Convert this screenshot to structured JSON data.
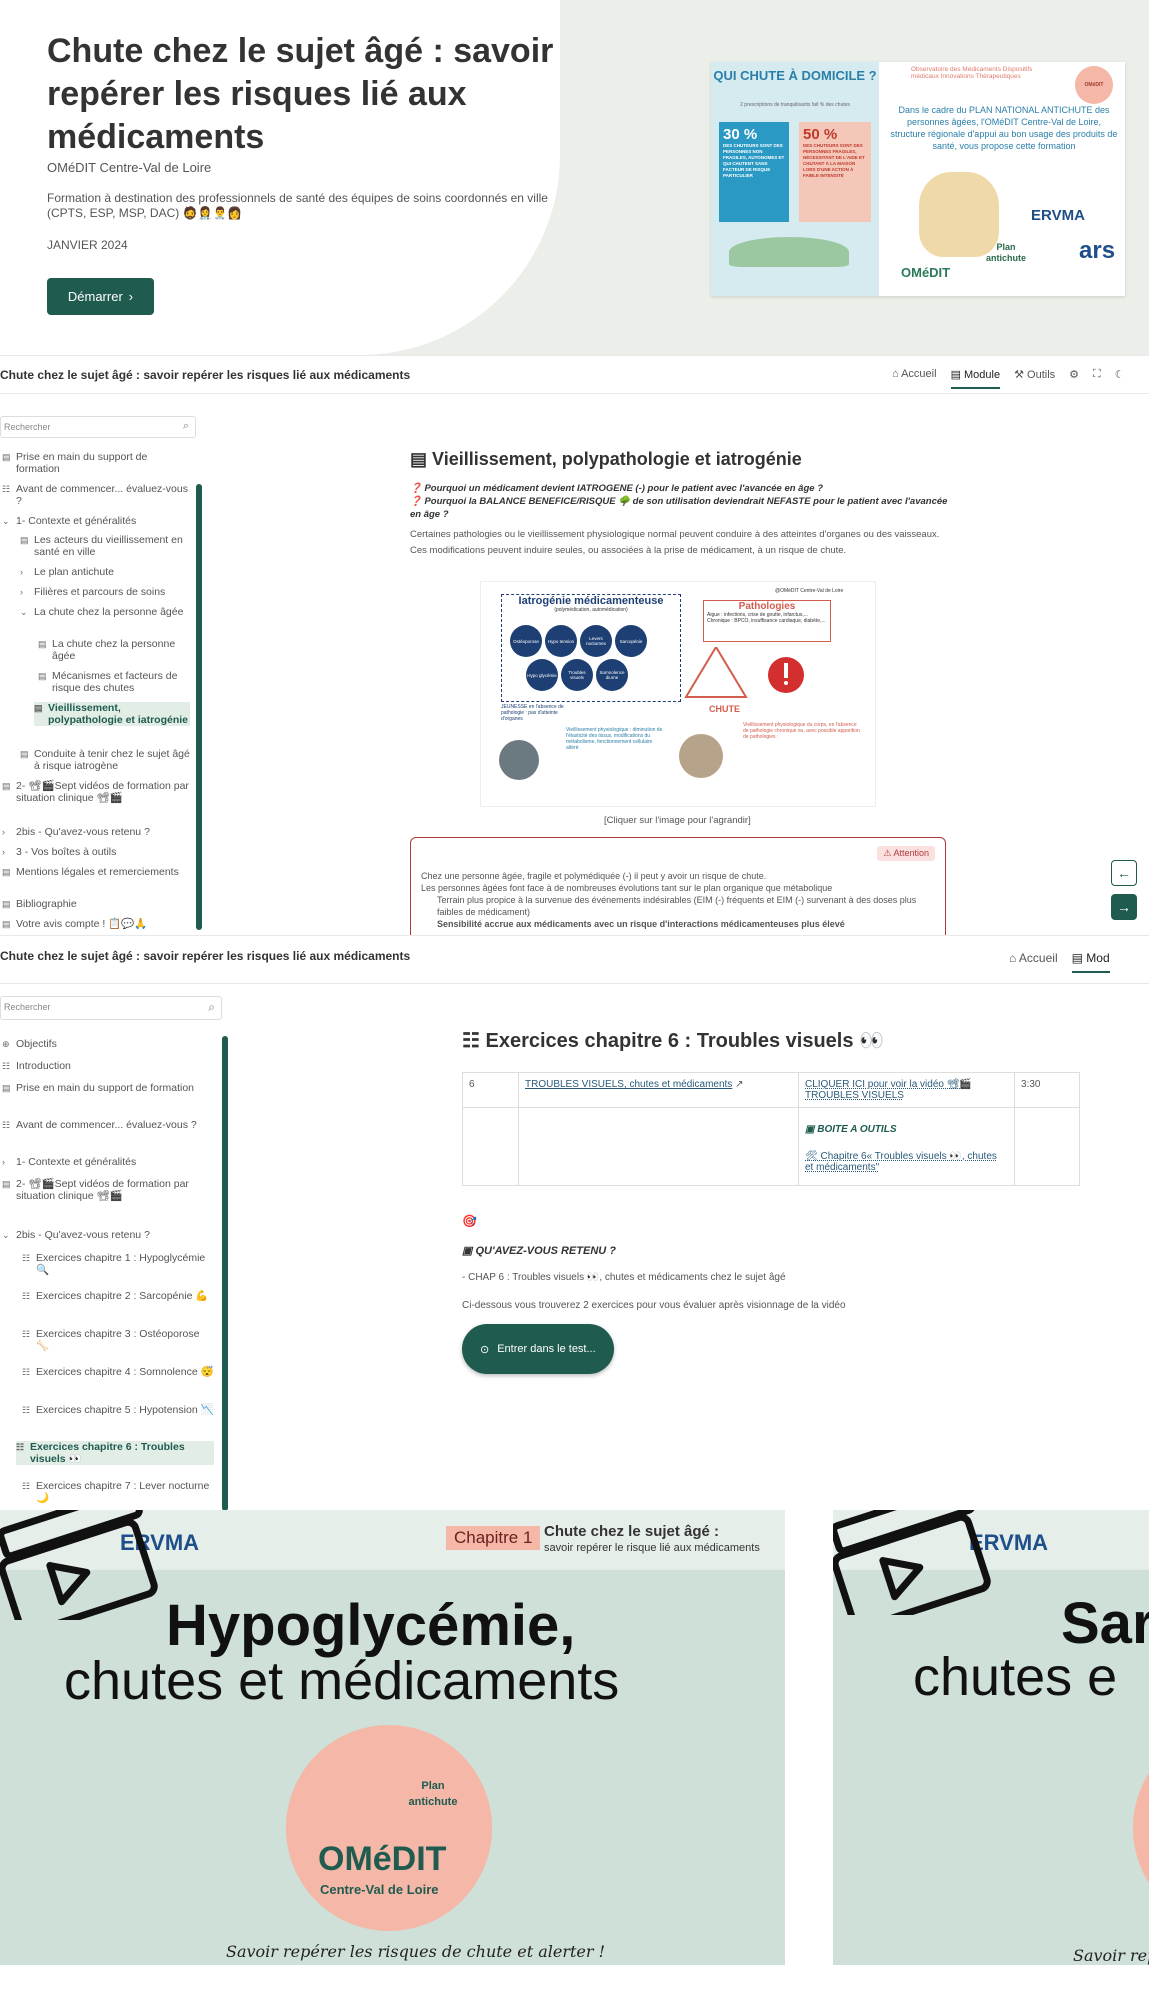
{
  "hero": {
    "title": "Chute chez le sujet âgé : savoir repérer les risques lié aux médicaments",
    "org": "OMéDIT Centre-Val de Loire",
    "description": "Formation à destination des professionnels de santé des équipes de soins coordonnés en ville (CPTS, ESP, MSP, DAC) 🧔👩‍⚕️👨‍⚕️👩",
    "date": "JANVIER 2024",
    "start_label": "Démarrer",
    "poster": {
      "question": "QUI CHUTE À DOMICILE ?",
      "subtitle": "2 prescriptions de tranquilisants fait % des chutes",
      "stat1": "30 %",
      "stat1_text": "DES CHUTEURS SONT DES PERSONNES NON FRAGILES, AUTONOMES ET QUI CHUTENT SANS FACTEUR DE RISQUE PARTICULIER",
      "stat2": "50 %",
      "stat2_text": "DES CHUTEURS SONT DES PERSONNES FRAGILES, NÉCESSITANT DE L'AIDE ET CHUTANT À LA MAISON LORS D'UNE ACTION À FAIBLE INTENSITÉ",
      "observatoire": "Observatoire des Médicaments Dispositifs médicaux Innovations Thérapeutiques",
      "logo_text": "OMéDIT",
      "text": "Dans le cadre du PLAN NATIONAL ANTICHUTE des personnes âgées, l'OMéDIT Centre-Val de Loire, structure régionale d'appui au bon usage des produits de santé, vous propose cette formation",
      "ervma": "ERVMA",
      "plan": "Plan antichute",
      "ars": "ars",
      "omedit": "OMéDIT"
    }
  },
  "app1": {
    "title": "Chute chez le sujet âgé : savoir repérer les risques lié aux médicaments",
    "nav": [
      "Accueil",
      "Module",
      "Outils"
    ],
    "search_placeholder": "Rechercher",
    "sidebar": [
      "Prise en main du support de formation",
      "Avant de commencer... évaluez-vous ?",
      "1- Contexte et généralités",
      "Les acteurs du vieillissement en santé en ville",
      "Le plan antichute",
      "Filières et parcours de soins",
      "La chute chez la personne âgée",
      "La chute chez la personne âgée",
      "Mécanismes et facteurs de risque des chutes",
      "Vieillissement, polypathologie et iatrogénie",
      "Conduite à tenir chez le sujet âgé à risque iatrogène",
      "2- 📽🎬Sept vidéos de formation par situation clinique 📽🎬",
      "2bis - Qu'avez-vous retenu ?",
      "3 - Vos boîtes à outils",
      "Mentions légales et remerciements",
      "Bibliographie",
      "Votre avis compte ! 📋💬🙏"
    ],
    "heading": "Vieillissement, polypathologie et iatrogénie",
    "q1": "❓ Pourquoi un médicament devient IATROGENE (-) pour le patient avec l'avancée en âge ?",
    "q2": "❓ Pourquoi la BALANCE BENEFICE/RISQUE 🌳 de son utilisation deviendrait NEFASTE pour le patient avec l'avancée en âge ?",
    "p1": "Certaines pathologies ou le vieillissement physiologique normal peuvent conduire à des atteintes d'organes ou des vaisseaux.",
    "p2": "Ces modifications peuvent induire seules, ou associées à la prise de médicament, à un risque de chute.",
    "diagram": {
      "title": "Iatrogénie médicamenteuse",
      "subtitle": "(polymédication, automédication)",
      "circles": [
        "Ostéoporose",
        "Hypo tension",
        "Levers nocturnes",
        "Sarcopénie",
        "Hypo glycémie",
        "Troubles visuels",
        "Somnolence diurne"
      ],
      "patho_title": "Pathologies",
      "patho_a": "Aigue : infections, crise de goutte, infarctus,...",
      "patho_c": "Chronique : BPCO, insuffisance cardiaque, diabète,...",
      "chute": "CHUTE",
      "credit": "@OMéDIT Centre-Val de Loire",
      "jeunesse": "JEUNESSE en l'absence de pathologie : pas d'atteinte d'organes",
      "vieil": "Vieillissement physiologique : diminution de l'élasticité des tissus, modifications du métabolisme, fonctionnement cellulaire altéré",
      "vieil2": "Vieillissement physiologique du corps, en l'absence de pathologie chronique ou, avec possible apparition de pathologies :"
    },
    "caption": "[Cliquer sur l'image pour l'agrandir]",
    "attention_label": "⚠ Attention",
    "attn1": "Chez une personne âgée, fragile et polymédiquée (-) il peut y avoir un risque de chute.",
    "attn2": "Les personnes âgées font face à de nombreuses évolutions tant sur le plan organique que métabolique",
    "attn3": "Terrain plus propice à la survenue des événements indésirables (EIM (-) fréquents et EIM (-) survenant à des doses plus faibles de médicament)",
    "attn4": "Sensibilité accrue aux médicaments avec un risque d'interactions médicamenteuses plus élevé"
  },
  "app2": {
    "title": "Chute chez le sujet âgé : savoir repérer les risques lié aux médicaments",
    "nav": [
      "Accueil",
      "Mod"
    ],
    "search_placeholder": "Rechercher",
    "sidebar": [
      "Objectifs",
      "Introduction",
      "Prise en main du support de formation",
      "Avant de commencer... évaluez-vous ?",
      "1- Contexte et généralités",
      "2- 📽🎬Sept vidéos de formation par situation clinique 📽🎬",
      "2bis - Qu'avez-vous retenu ?",
      "Exercices chapitre 1 : Hypoglycémie 🔍",
      "Exercices chapitre 2 : Sarcopénie 💪",
      "Exercices chapitre 3 : Ostéoporose 🦴",
      "Exercices chapitre 4 : Somnolence 😴",
      "Exercices chapitre 5 : Hypotension 📉",
      "Exercices chapitre 6 : Troubles visuels 👀",
      "Exercices chapitre 7 : Lever nocturne 🌙"
    ],
    "heading": "Exercices chapitre 6 : Troubles visuels 👀",
    "table": {
      "num": "6",
      "link": "TROUBLES VISUELS, chutes et médicaments",
      "video": "CLIQUER ICI pour voir la vidéo 📽🎬 TROUBLES VISUELS",
      "duration": "3:30",
      "toolbox": "BOITE A OUTILS",
      "toolbox_link": "🛠 Chapitre 6« Troubles visuels 👀, chutes et médicaments\""
    },
    "target": "🎯",
    "retenu": "QU'AVEZ-VOUS RETENU ?",
    "chap": "- CHAP 6 : Troubles visuels 👀, chutes et médicaments chez le sujet âgé",
    "below": "Ci-dessous vous trouverez 2 exercices pour vous évaluer après visionnage de la vidéo",
    "start": "Entrer dans le test..."
  },
  "slides": {
    "chapter": "Chapitre 1",
    "head_title": "Chute chez le sujet âgé :",
    "head_sub": "savoir repérer le risque lié aux médicaments",
    "s1_title": "Hypoglycémie,",
    "s1_sub": "chutes et médicaments",
    "ervma": "ERVMA",
    "plan": "Plan antichute",
    "omedit": "OMéDIT",
    "region": "Centre-Val de Loire",
    "tagline": "Savoir repérer les risques de chute et alerter !",
    "s2_title": "Sar",
    "s2_sub": "chutes e",
    "s2_tagline": "Savoir rep"
  },
  "colors": {
    "primary": "#1f5b4f",
    "accent": "#b03a3a",
    "slide_bg": "#cfe0d8",
    "pink": "#f4b7a8"
  }
}
